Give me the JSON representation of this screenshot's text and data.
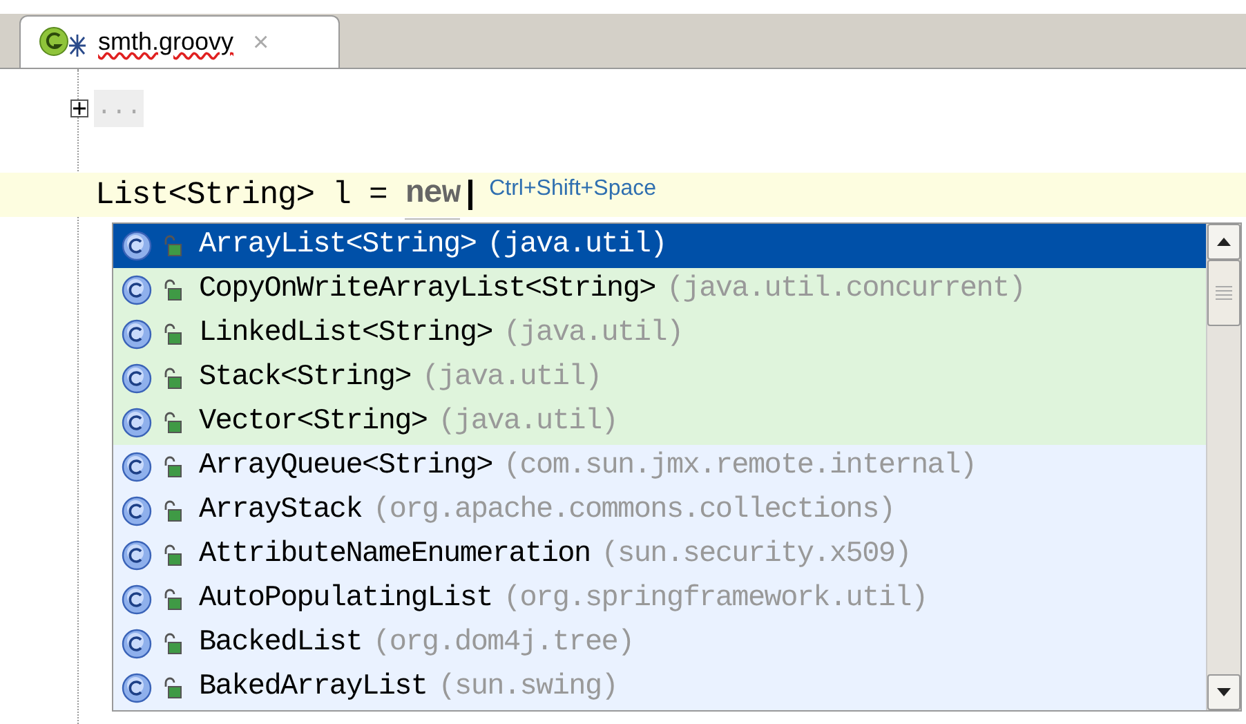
{
  "tab": {
    "title": "smth.groovy",
    "close": "×"
  },
  "editor": {
    "fold_placeholder": "...",
    "code": "List<String> l = ",
    "keyword": "new",
    "hint": "Ctrl+Shift+Space"
  },
  "completion": {
    "items": [
      {
        "name": "ArrayList<String>",
        "package": "(java.util)",
        "selected": true
      },
      {
        "name": "CopyOnWriteArrayList<String>",
        "package": "(java.util.concurrent)",
        "kind": "expected",
        "selected": false
      },
      {
        "name": "LinkedList<String>",
        "package": "(java.util)",
        "kind": "expected",
        "selected": false
      },
      {
        "name": "Stack<String>",
        "package": "(java.util)",
        "kind": "expected",
        "selected": false
      },
      {
        "name": "Vector<String>",
        "package": "(java.util)",
        "kind": "expected",
        "selected": false
      },
      {
        "name": "ArrayQueue<String>",
        "package": "(com.sun.jmx.remote.internal)",
        "kind": "other",
        "selected": false
      },
      {
        "name": "ArrayStack",
        "package": "(org.apache.commons.collections)",
        "kind": "other",
        "selected": false
      },
      {
        "name": "AttributeNameEnumeration",
        "package": "(sun.security.x509)",
        "kind": "other",
        "selected": false
      },
      {
        "name": "AutoPopulatingList",
        "package": "(org.springframework.util)",
        "kind": "other",
        "selected": false
      },
      {
        "name": "BackedList",
        "package": "(org.dom4j.tree)",
        "kind": "other",
        "selected": false
      },
      {
        "name": "BakedArrayList",
        "package": "(sun.swing)",
        "kind": "other",
        "selected": false
      }
    ]
  }
}
